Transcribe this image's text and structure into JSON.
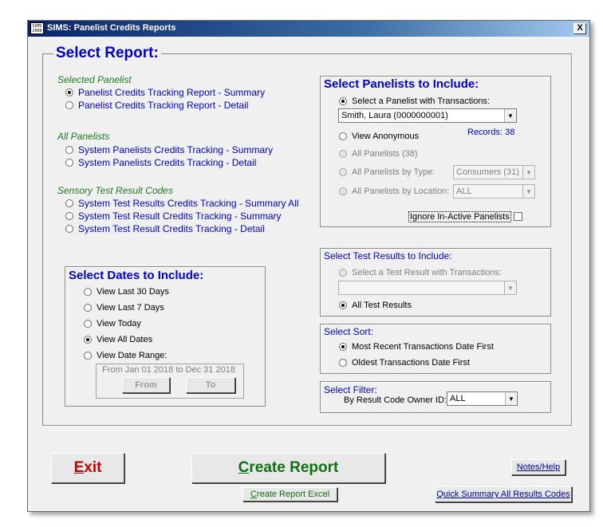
{
  "window": {
    "title": "SIMS: Panelist Credits Reports",
    "app_icon_text": "SIMS 2000",
    "close_glyph": "X"
  },
  "select_report": {
    "heading": "Select Report:",
    "groups": [
      {
        "label": "Selected Panelist",
        "options": [
          {
            "label": "Panelist Credits Tracking Report - Summary",
            "selected": true
          },
          {
            "label": "Panelist Credits Tracking Report - Detail",
            "selected": false
          }
        ]
      },
      {
        "label": "All Panelists",
        "options": [
          {
            "label": "System Panelists Credits Tracking - Summary",
            "selected": false
          },
          {
            "label": "System Panelists Credits Tracking - Detail",
            "selected": false
          }
        ]
      },
      {
        "label": "Sensory Test Result Codes",
        "options": [
          {
            "label": "System Test Results Credits Tracking - Summary All",
            "selected": false
          },
          {
            "label": "System Test Result Credits Tracking - Summary",
            "selected": false
          },
          {
            "label": "System Test Result Credits Tracking - Detail",
            "selected": false
          }
        ]
      }
    ]
  },
  "dates": {
    "heading": "Select Dates to Include:",
    "options": [
      {
        "label": "View Last 30 Days",
        "selected": false
      },
      {
        "label": "View Last 7 Days",
        "selected": false
      },
      {
        "label": "View Today",
        "selected": false
      },
      {
        "label": "View All Dates",
        "selected": true
      },
      {
        "label": "View Date Range:",
        "selected": false
      }
    ],
    "range_text": "From Jan 01 2018 to Dec 31 2018",
    "from_label": "From",
    "to_label": "To"
  },
  "panelists": {
    "heading": "Select Panelists to Include:",
    "with_transactions_label": "Select a Panelist with Transactions:",
    "panelist_value": "Smith, Laura  (0000000001)",
    "view_anonymous_label": "View Anonymous",
    "records_text": "Records: 38",
    "all_panelists_label": "All Panelists (38)",
    "by_type_label": "All Panelists by Type:",
    "type_value": "Consumers (31)",
    "by_location_label": "All Panelists by Location:",
    "location_value": "ALL",
    "ignore_inactive_label": "Ignore In-Active Panelists"
  },
  "test_results": {
    "heading": "Select Test Results to Include:",
    "with_transactions_label": "Select a Test Result with Transactions:",
    "value": "",
    "all_label": "All Test Results"
  },
  "sort": {
    "heading": "Select Sort:",
    "options": [
      {
        "label": "Most Recent Transactions Date First",
        "selected": true
      },
      {
        "label": "Oldest Transactions Date First",
        "selected": false
      }
    ]
  },
  "filter": {
    "heading": "Select Filter:",
    "label": "By Result Code Owner ID:",
    "value": "ALL"
  },
  "buttons": {
    "exit": {
      "accel": "E",
      "rest": "xit"
    },
    "create_report": {
      "accel": "C",
      "rest": "reate Report"
    },
    "create_report_excel": {
      "accel": "C",
      "rest": "reate Report Excel"
    },
    "notes_help": "Notes/Help",
    "quick_summary": {
      "accel": "Q",
      "rest": "uick Summary All Results Codes"
    }
  },
  "colors": {
    "heading_blue": "#0000c8",
    "category_green": "#1a7a1a",
    "exit_red": "#c00000",
    "create_green": "#107010"
  }
}
